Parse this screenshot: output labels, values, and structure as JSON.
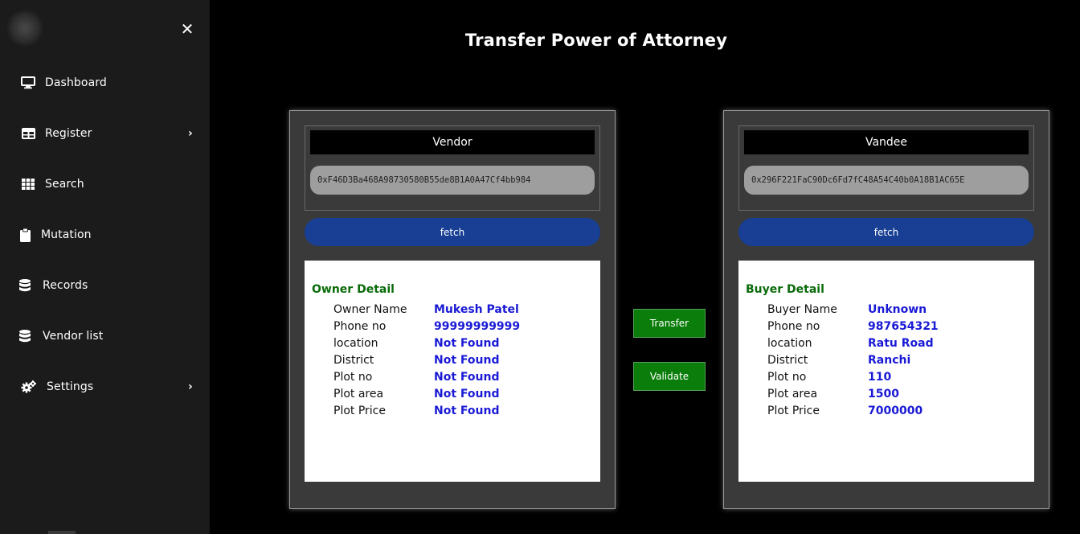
{
  "sidebar": {
    "close_glyph": "✕",
    "items": [
      {
        "label": "Dashboard",
        "icon": "monitor-icon",
        "has_submenu": false
      },
      {
        "label": "Register",
        "icon": "table-icon",
        "has_submenu": true
      },
      {
        "label": "Search",
        "icon": "grid-icon",
        "has_submenu": false
      },
      {
        "label": "Mutation",
        "icon": "clipboard-icon",
        "has_submenu": false
      },
      {
        "label": "Records",
        "icon": "database-icon",
        "has_submenu": false
      },
      {
        "label": "Vendor list",
        "icon": "database-icon",
        "has_submenu": false
      },
      {
        "label": "Settings",
        "icon": "gears-icon",
        "has_submenu": true
      }
    ]
  },
  "page": {
    "title": "Transfer Power of Attorney"
  },
  "vendor": {
    "header": "Vendor",
    "address": "0xF46D3Ba468A98730580B55de8B1A0A47Cf4bb984",
    "fetch_label": "fetch",
    "detail_title": "Owner Detail",
    "rows": [
      {
        "key": "Owner Name",
        "value": "Mukesh Patel"
      },
      {
        "key": "Phone no",
        "value": "99999999999"
      },
      {
        "key": "location",
        "value": "Not Found"
      },
      {
        "key": "District",
        "value": "Not Found"
      },
      {
        "key": "Plot no",
        "value": "Not Found"
      },
      {
        "key": "Plot area",
        "value": "Not Found"
      },
      {
        "key": "Plot Price",
        "value": "Not Found"
      }
    ]
  },
  "vandee": {
    "header": "Vandee",
    "address": "0x296F221FaC90Dc6Fd7fC48A54C40b0A18B1AC65E",
    "fetch_label": "fetch",
    "detail_title": "Buyer Detail",
    "rows": [
      {
        "key": "Buyer Name",
        "value": "Unknown"
      },
      {
        "key": "Phone no",
        "value": "987654321"
      },
      {
        "key": "location",
        "value": "Ratu Road"
      },
      {
        "key": "District",
        "value": "Ranchi"
      },
      {
        "key": "Plot no",
        "value": "110"
      },
      {
        "key": "Plot area",
        "value": "1500"
      },
      {
        "key": "Plot Price",
        "value": "7000000"
      }
    ]
  },
  "actions": {
    "transfer_label": "Transfer",
    "validate_label": "Validate"
  },
  "colors": {
    "sidebar_bg": "#1b1b1b",
    "fetch_button": "#183f93",
    "action_button": "#0a7d0a",
    "detail_title": "#0a6b0a",
    "value_text": "#1a1ad6"
  }
}
